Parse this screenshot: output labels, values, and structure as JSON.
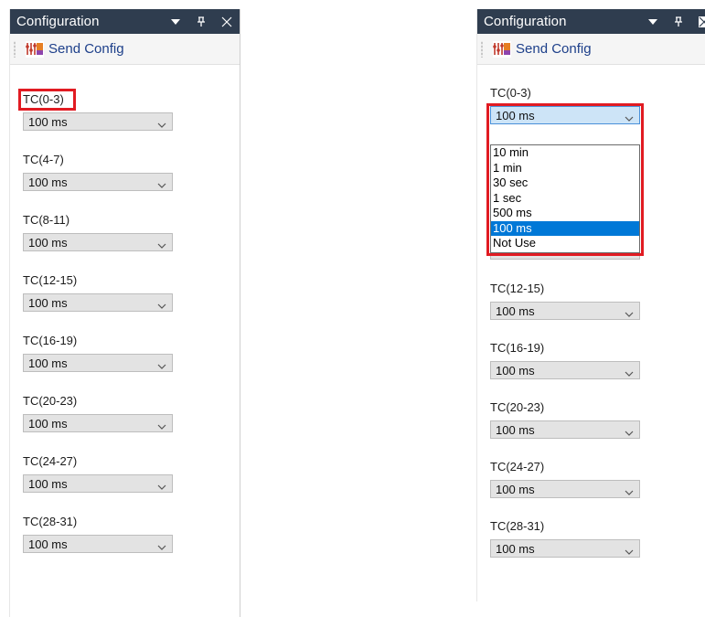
{
  "panel_title": "Configuration",
  "toolbar": {
    "send_label": "Send Config",
    "send_icon": "send-config-icon"
  },
  "title_icons": [
    "dropdown-arrow-icon",
    "pin-icon",
    "close-icon"
  ],
  "channels": [
    {
      "label": "TC(0-3)",
      "value": "100 ms"
    },
    {
      "label": "TC(4-7)",
      "value": "100 ms"
    },
    {
      "label": "TC(8-11)",
      "value": "100 ms"
    },
    {
      "label": "TC(12-15)",
      "value": "100 ms"
    },
    {
      "label": "TC(16-19)",
      "value": "100 ms"
    },
    {
      "label": "TC(20-23)",
      "value": "100 ms"
    },
    {
      "label": "TC(24-27)",
      "value": "100 ms"
    },
    {
      "label": "TC(28-31)",
      "value": "100 ms"
    }
  ],
  "right_panel": {
    "open_dropdown_label": "TC(0-3)",
    "open_dropdown_value": "100 ms",
    "dropdown_options": [
      "10 min",
      "1 min",
      "30 sec",
      "1 sec",
      "500 ms",
      "100 ms",
      "Not Use"
    ],
    "selected_option": "100 ms",
    "visible_channels": [
      {
        "label": "TC(12-15)",
        "value": "100 ms"
      },
      {
        "label": "TC(16-19)",
        "value": "100 ms"
      },
      {
        "label": "TC(20-23)",
        "value": "100 ms"
      },
      {
        "label": "TC(24-27)",
        "value": "100 ms"
      },
      {
        "label": "TC(28-31)",
        "value": "100 ms"
      }
    ]
  },
  "colors": {
    "titlebar": "#2f3d4f",
    "highlight": "#e11b22",
    "selection": "#0078d7",
    "link": "#1d3f8a"
  }
}
